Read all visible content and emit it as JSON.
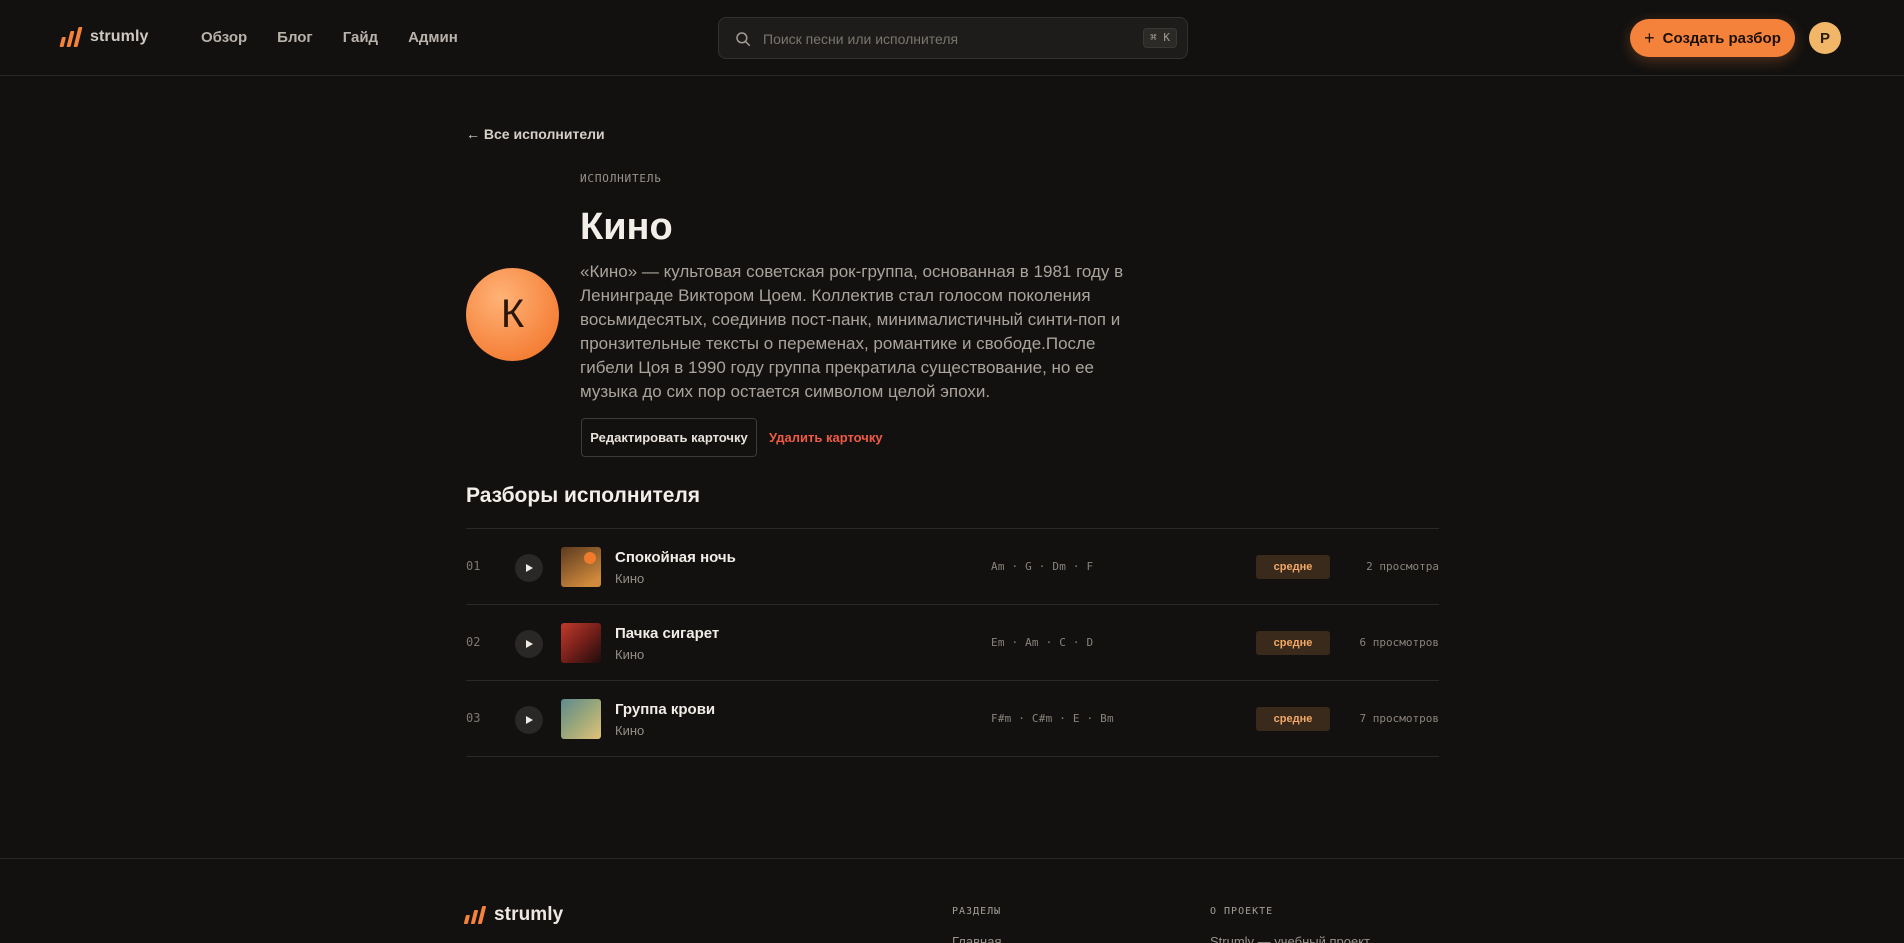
{
  "header": {
    "logo_text": "strumly",
    "nav": [
      "Обзор",
      "Блог",
      "Гайд",
      "Админ"
    ],
    "search_placeholder": "Поиск песни или исполнителя",
    "search_shortcut": "⌘ K",
    "create_label": "Создать разбор",
    "avatar_initial": "P"
  },
  "artist": {
    "back_label": "← Все исполнители",
    "eyebrow": "ИСПОЛНИТЕЛЬ",
    "name": "Кино",
    "initial": "К",
    "bio": "«Кино» — культовая советская рок-группа, основанная в 1981 году в Ленинграде Виктором Цоем. Коллектив стал голосом поколения восьмидесятых, соединив пост-панк, минималистичный синти-поп и пронзительные тексты о переменах, романтике и свободе.После гибели Цоя в 1990 году группа прекратила существование, но ее музыка до сих пор остается символом целой эпохи.",
    "edit_label": "Редактировать карточку",
    "delete_label": "Удалить карточку"
  },
  "tracks_section": {
    "title": "Разборы исполнителя",
    "items": [
      {
        "num": "01",
        "title": "Спокойная ночь",
        "artist": "Кино",
        "chords": "Am · G · Dm · F",
        "level": "средне",
        "views": "2 просмотра"
      },
      {
        "num": "02",
        "title": "Пачка сигарет",
        "artist": "Кино",
        "chords": "Em · Am · C · D",
        "level": "средне",
        "views": "6 просмотров"
      },
      {
        "num": "03",
        "title": "Группа крови",
        "artist": "Кино",
        "chords": "F#m · C#m · E · Bm",
        "level": "средне",
        "views": "7 просмотров"
      }
    ]
  },
  "footer": {
    "logo_text": "strumly",
    "sections_heading": "РАЗДЕЛЫ",
    "sections_first_link": "Главная",
    "about_heading": "О ПРОЕКТЕ",
    "about_text": "Strumly — учебный проект"
  },
  "colors": {
    "background": "#121110",
    "accent": "#f5823a",
    "danger": "#f05a44",
    "level_badge_bg": "#3a2a1c",
    "level_badge_text": "#f2a866"
  },
  "icons": [
    "logo-bars-icon",
    "search-icon",
    "plus-icon",
    "play-icon"
  ]
}
